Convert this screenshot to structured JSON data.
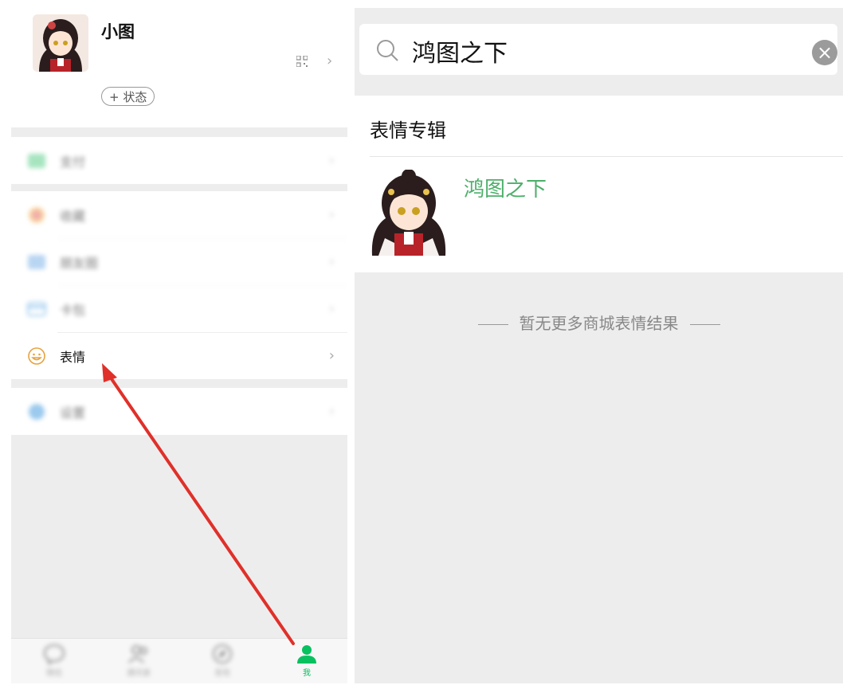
{
  "profile": {
    "nickname": "小图",
    "status_button": "+ 状态"
  },
  "menu": {
    "groups": [
      [
        {
          "label": "支付",
          "icon": "pay-icon",
          "blurred": true
        }
      ],
      [
        {
          "label": "收藏",
          "icon": "favorites-icon",
          "blurred": true
        },
        {
          "label": "朋友圈",
          "icon": "moments-icon",
          "blurred": true
        },
        {
          "label": "卡包",
          "icon": "card-icon",
          "blurred": true
        },
        {
          "label": "表情",
          "icon": "sticker-icon",
          "blurred": false
        }
      ],
      [
        {
          "label": "设置",
          "icon": "settings-icon",
          "blurred": true
        }
      ]
    ]
  },
  "tabbar": {
    "tabs": [
      {
        "label": "微信",
        "icon": "chat-icon",
        "active": false
      },
      {
        "label": "通讯录",
        "icon": "contacts-icon",
        "active": false
      },
      {
        "label": "发现",
        "icon": "discover-icon",
        "active": false
      },
      {
        "label": "我",
        "icon": "me-icon",
        "active": true
      }
    ]
  },
  "search": {
    "query": "鸿图之下",
    "clear_icon": "close-icon"
  },
  "results": {
    "section_title": "表情专辑",
    "items": [
      {
        "name": "鸿图之下"
      }
    ],
    "no_more_text": "暂无更多商城表情结果"
  },
  "colors": {
    "accent_green": "#07c160",
    "result_name_green": "#4caf6a",
    "annotation_arrow": "#e0302a",
    "background_gray": "#ededed"
  }
}
